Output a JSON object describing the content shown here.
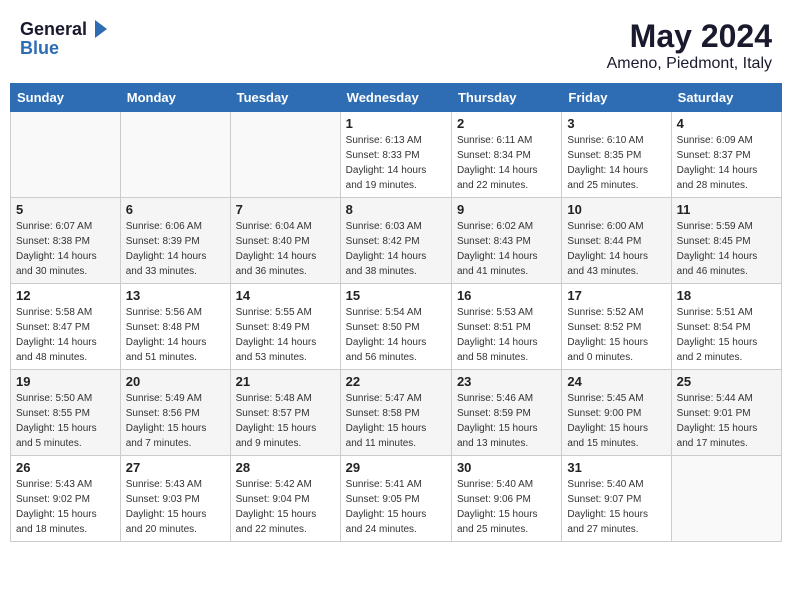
{
  "header": {
    "logo_general": "General",
    "logo_blue": "Blue",
    "month": "May 2024",
    "location": "Ameno, Piedmont, Italy"
  },
  "weekdays": [
    "Sunday",
    "Monday",
    "Tuesday",
    "Wednesday",
    "Thursday",
    "Friday",
    "Saturday"
  ],
  "weeks": [
    [
      {
        "day": "",
        "info": ""
      },
      {
        "day": "",
        "info": ""
      },
      {
        "day": "",
        "info": ""
      },
      {
        "day": "1",
        "info": "Sunrise: 6:13 AM\nSunset: 8:33 PM\nDaylight: 14 hours\nand 19 minutes."
      },
      {
        "day": "2",
        "info": "Sunrise: 6:11 AM\nSunset: 8:34 PM\nDaylight: 14 hours\nand 22 minutes."
      },
      {
        "day": "3",
        "info": "Sunrise: 6:10 AM\nSunset: 8:35 PM\nDaylight: 14 hours\nand 25 minutes."
      },
      {
        "day": "4",
        "info": "Sunrise: 6:09 AM\nSunset: 8:37 PM\nDaylight: 14 hours\nand 28 minutes."
      }
    ],
    [
      {
        "day": "5",
        "info": "Sunrise: 6:07 AM\nSunset: 8:38 PM\nDaylight: 14 hours\nand 30 minutes."
      },
      {
        "day": "6",
        "info": "Sunrise: 6:06 AM\nSunset: 8:39 PM\nDaylight: 14 hours\nand 33 minutes."
      },
      {
        "day": "7",
        "info": "Sunrise: 6:04 AM\nSunset: 8:40 PM\nDaylight: 14 hours\nand 36 minutes."
      },
      {
        "day": "8",
        "info": "Sunrise: 6:03 AM\nSunset: 8:42 PM\nDaylight: 14 hours\nand 38 minutes."
      },
      {
        "day": "9",
        "info": "Sunrise: 6:02 AM\nSunset: 8:43 PM\nDaylight: 14 hours\nand 41 minutes."
      },
      {
        "day": "10",
        "info": "Sunrise: 6:00 AM\nSunset: 8:44 PM\nDaylight: 14 hours\nand 43 minutes."
      },
      {
        "day": "11",
        "info": "Sunrise: 5:59 AM\nSunset: 8:45 PM\nDaylight: 14 hours\nand 46 minutes."
      }
    ],
    [
      {
        "day": "12",
        "info": "Sunrise: 5:58 AM\nSunset: 8:47 PM\nDaylight: 14 hours\nand 48 minutes."
      },
      {
        "day": "13",
        "info": "Sunrise: 5:56 AM\nSunset: 8:48 PM\nDaylight: 14 hours\nand 51 minutes."
      },
      {
        "day": "14",
        "info": "Sunrise: 5:55 AM\nSunset: 8:49 PM\nDaylight: 14 hours\nand 53 minutes."
      },
      {
        "day": "15",
        "info": "Sunrise: 5:54 AM\nSunset: 8:50 PM\nDaylight: 14 hours\nand 56 minutes."
      },
      {
        "day": "16",
        "info": "Sunrise: 5:53 AM\nSunset: 8:51 PM\nDaylight: 14 hours\nand 58 minutes."
      },
      {
        "day": "17",
        "info": "Sunrise: 5:52 AM\nSunset: 8:52 PM\nDaylight: 15 hours\nand 0 minutes."
      },
      {
        "day": "18",
        "info": "Sunrise: 5:51 AM\nSunset: 8:54 PM\nDaylight: 15 hours\nand 2 minutes."
      }
    ],
    [
      {
        "day": "19",
        "info": "Sunrise: 5:50 AM\nSunset: 8:55 PM\nDaylight: 15 hours\nand 5 minutes."
      },
      {
        "day": "20",
        "info": "Sunrise: 5:49 AM\nSunset: 8:56 PM\nDaylight: 15 hours\nand 7 minutes."
      },
      {
        "day": "21",
        "info": "Sunrise: 5:48 AM\nSunset: 8:57 PM\nDaylight: 15 hours\nand 9 minutes."
      },
      {
        "day": "22",
        "info": "Sunrise: 5:47 AM\nSunset: 8:58 PM\nDaylight: 15 hours\nand 11 minutes."
      },
      {
        "day": "23",
        "info": "Sunrise: 5:46 AM\nSunset: 8:59 PM\nDaylight: 15 hours\nand 13 minutes."
      },
      {
        "day": "24",
        "info": "Sunrise: 5:45 AM\nSunset: 9:00 PM\nDaylight: 15 hours\nand 15 minutes."
      },
      {
        "day": "25",
        "info": "Sunrise: 5:44 AM\nSunset: 9:01 PM\nDaylight: 15 hours\nand 17 minutes."
      }
    ],
    [
      {
        "day": "26",
        "info": "Sunrise: 5:43 AM\nSunset: 9:02 PM\nDaylight: 15 hours\nand 18 minutes."
      },
      {
        "day": "27",
        "info": "Sunrise: 5:43 AM\nSunset: 9:03 PM\nDaylight: 15 hours\nand 20 minutes."
      },
      {
        "day": "28",
        "info": "Sunrise: 5:42 AM\nSunset: 9:04 PM\nDaylight: 15 hours\nand 22 minutes."
      },
      {
        "day": "29",
        "info": "Sunrise: 5:41 AM\nSunset: 9:05 PM\nDaylight: 15 hours\nand 24 minutes."
      },
      {
        "day": "30",
        "info": "Sunrise: 5:40 AM\nSunset: 9:06 PM\nDaylight: 15 hours\nand 25 minutes."
      },
      {
        "day": "31",
        "info": "Sunrise: 5:40 AM\nSunset: 9:07 PM\nDaylight: 15 hours\nand 27 minutes."
      },
      {
        "day": "",
        "info": ""
      }
    ]
  ]
}
